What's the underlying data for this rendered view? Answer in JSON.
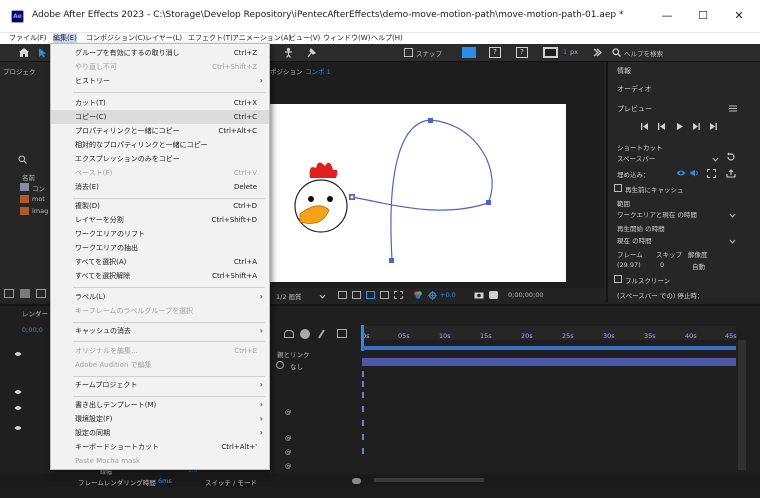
{
  "window": {
    "title": "Adobe After Effects 2023 - C:\\Storage\\Develop Repository\\iPentecAfterEffects\\demo-move-motion-path\\move-motion-path-01.aep *",
    "app_icon": "Ae",
    "minimize": "—",
    "maximize": "☐",
    "close": "✕"
  },
  "menubar": [
    "ファイル(F)",
    "編集(E)",
    "コンポジション(C)",
    "レイヤー(L)",
    "エフェクト(T)",
    "アニメーション(A)",
    "ビュー(V)",
    "ウィンドウ(W)",
    "ヘルプ(H)"
  ],
  "toolbar": {
    "snap": "スナップ",
    "stroke_label": "px",
    "stroke_value": "1",
    "help_search": "ヘルプを検索"
  },
  "project_panel": {
    "tab": "プロジェク",
    "name_header": "名前",
    "items": [
      "コン",
      "mot",
      "imag"
    ]
  },
  "comp_viewer": {
    "tab_prefix": "ポジション",
    "tab_name": "コンポ 1",
    "zoom": "1/2 画質",
    "exposure": "+0.0",
    "timecode": "0;00;00;00"
  },
  "right_panel": {
    "info": "情報",
    "audio": "オーディオ",
    "preview": "プレビュー",
    "shortcut_label": "ショートカット",
    "shortcut_value": "スペースバー",
    "embed_label": "埋め込み：",
    "cache_before": "再生前にキャッシュ",
    "range_label": "範囲",
    "range_value": "ワークエリアと現在 の時間",
    "play_from_label": "再生開始 の時間",
    "play_from_value": "現在 の時間",
    "frame_label": "フレーム",
    "skip_label": "スキップ",
    "resolution_label": "解像度",
    "frame_value": "(29.97)",
    "skip_value": "0",
    "resolution_value": "自動",
    "fullscreen": "フルスクリーン",
    "stop_hint": "(スペースバー での) 停止時："
  },
  "timeline": {
    "tab": "レンダー",
    "timecode": "0;00;0",
    "parent_link": "親とリンク",
    "parent_none": "なし",
    "ruler": [
      "0s",
      "05s",
      "10s",
      "15s",
      "20s",
      "25s",
      "30s",
      "35s",
      "40s",
      "45s"
    ],
    "bottom_label": "フレームレンダリング時間",
    "render_time": "6ms",
    "switch_mode": "スイッチ / モード",
    "stroke_item": "線幅",
    "stroke_val": "1.0"
  },
  "edit_menu": {
    "items": [
      {
        "label": "グループを有効にするの取り消し",
        "shortcut": "Ctrl+Z",
        "disabled": false
      },
      {
        "label": "やり直し不可",
        "shortcut": "Ctrl+Shift+Z",
        "disabled": true
      },
      {
        "label": "ヒストリー",
        "shortcut": "",
        "disabled": false,
        "submenu": true
      },
      {
        "sep": true
      },
      {
        "label": "カット(T)",
        "shortcut": "Ctrl+X",
        "disabled": false
      },
      {
        "label": "コピー(C)",
        "shortcut": "Ctrl+C",
        "disabled": false,
        "highlight": true
      },
      {
        "label": "プロパティリンクと一緒にコピー",
        "shortcut": "Ctrl+Alt+C",
        "disabled": false
      },
      {
        "label": "相対的なプロパティリンクと一緒にコピー",
        "shortcut": "",
        "disabled": false
      },
      {
        "label": "エクスプレッションのみをコピー",
        "shortcut": "",
        "disabled": false
      },
      {
        "label": "ペースト(P)",
        "shortcut": "Ctrl+V",
        "disabled": true
      },
      {
        "label": "消去(E)",
        "shortcut": "Delete",
        "disabled": false
      },
      {
        "sep": true
      },
      {
        "label": "複製(D)",
        "shortcut": "Ctrl+D",
        "disabled": false
      },
      {
        "label": "レイヤーを分割",
        "shortcut": "Ctrl+Shift+D",
        "disabled": false
      },
      {
        "label": "ワークエリアのリフト",
        "shortcut": "",
        "disabled": false
      },
      {
        "label": "ワークエリアの抽出",
        "shortcut": "",
        "disabled": false
      },
      {
        "label": "すべてを選択(A)",
        "shortcut": "Ctrl+A",
        "disabled": false
      },
      {
        "label": "すべてを選択解除",
        "shortcut": "Ctrl+Shift+A",
        "disabled": false
      },
      {
        "sep": true
      },
      {
        "label": "ラベル(L)",
        "shortcut": "",
        "disabled": false,
        "submenu": true
      },
      {
        "label": "キーフレームのラベルグループを選択",
        "shortcut": "",
        "disabled": true
      },
      {
        "sep": true
      },
      {
        "label": "キャッシュの消去",
        "shortcut": "",
        "disabled": false,
        "submenu": true
      },
      {
        "sep": true
      },
      {
        "label": "オリジナルを編集...",
        "shortcut": "Ctrl+E",
        "disabled": true
      },
      {
        "label": "Adobe Audition で編集",
        "shortcut": "",
        "disabled": true
      },
      {
        "sep": true
      },
      {
        "label": "チームプロジェクト",
        "shortcut": "",
        "disabled": false,
        "submenu": true
      },
      {
        "sep": true
      },
      {
        "label": "書き出しテンプレート(M)",
        "shortcut": "",
        "disabled": false,
        "submenu": true
      },
      {
        "label": "環境設定(F)",
        "shortcut": "",
        "disabled": false,
        "submenu": true
      },
      {
        "label": "設定の同期",
        "shortcut": "",
        "disabled": false,
        "submenu": true
      },
      {
        "label": "キーボードショートカット",
        "shortcut": "Ctrl+Alt+'",
        "disabled": false
      },
      {
        "label": "Paste Mocha mask",
        "shortcut": "",
        "disabled": true
      }
    ]
  },
  "colors": {
    "accent": "#2d8ceb",
    "path": "#4d64c6",
    "timeline_bar": "#4f57a8",
    "chicken_comb": "#e02020",
    "chicken_beak": "#f5a31a"
  }
}
